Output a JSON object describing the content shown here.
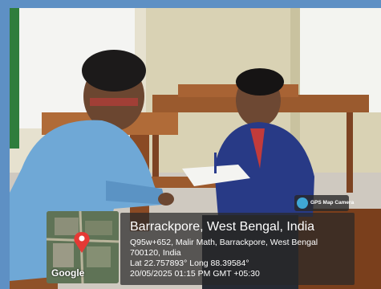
{
  "overlay": {
    "title": "Barrackpore, West Bengal, India",
    "line1": "Q95w+652, Malir Math, Barrackpore, West Bengal",
    "line2": "700120, India",
    "line3": "Lat 22.757893° Long 88.39584°",
    "line4": "20/05/2025 01:15 PM GMT +05:30"
  },
  "map": {
    "brand": "Google",
    "pin_color": "#e53935",
    "icon": "map-pin-icon"
  },
  "badge": {
    "label": "GPS Map Camera",
    "icon": "gps-camera-icon"
  }
}
